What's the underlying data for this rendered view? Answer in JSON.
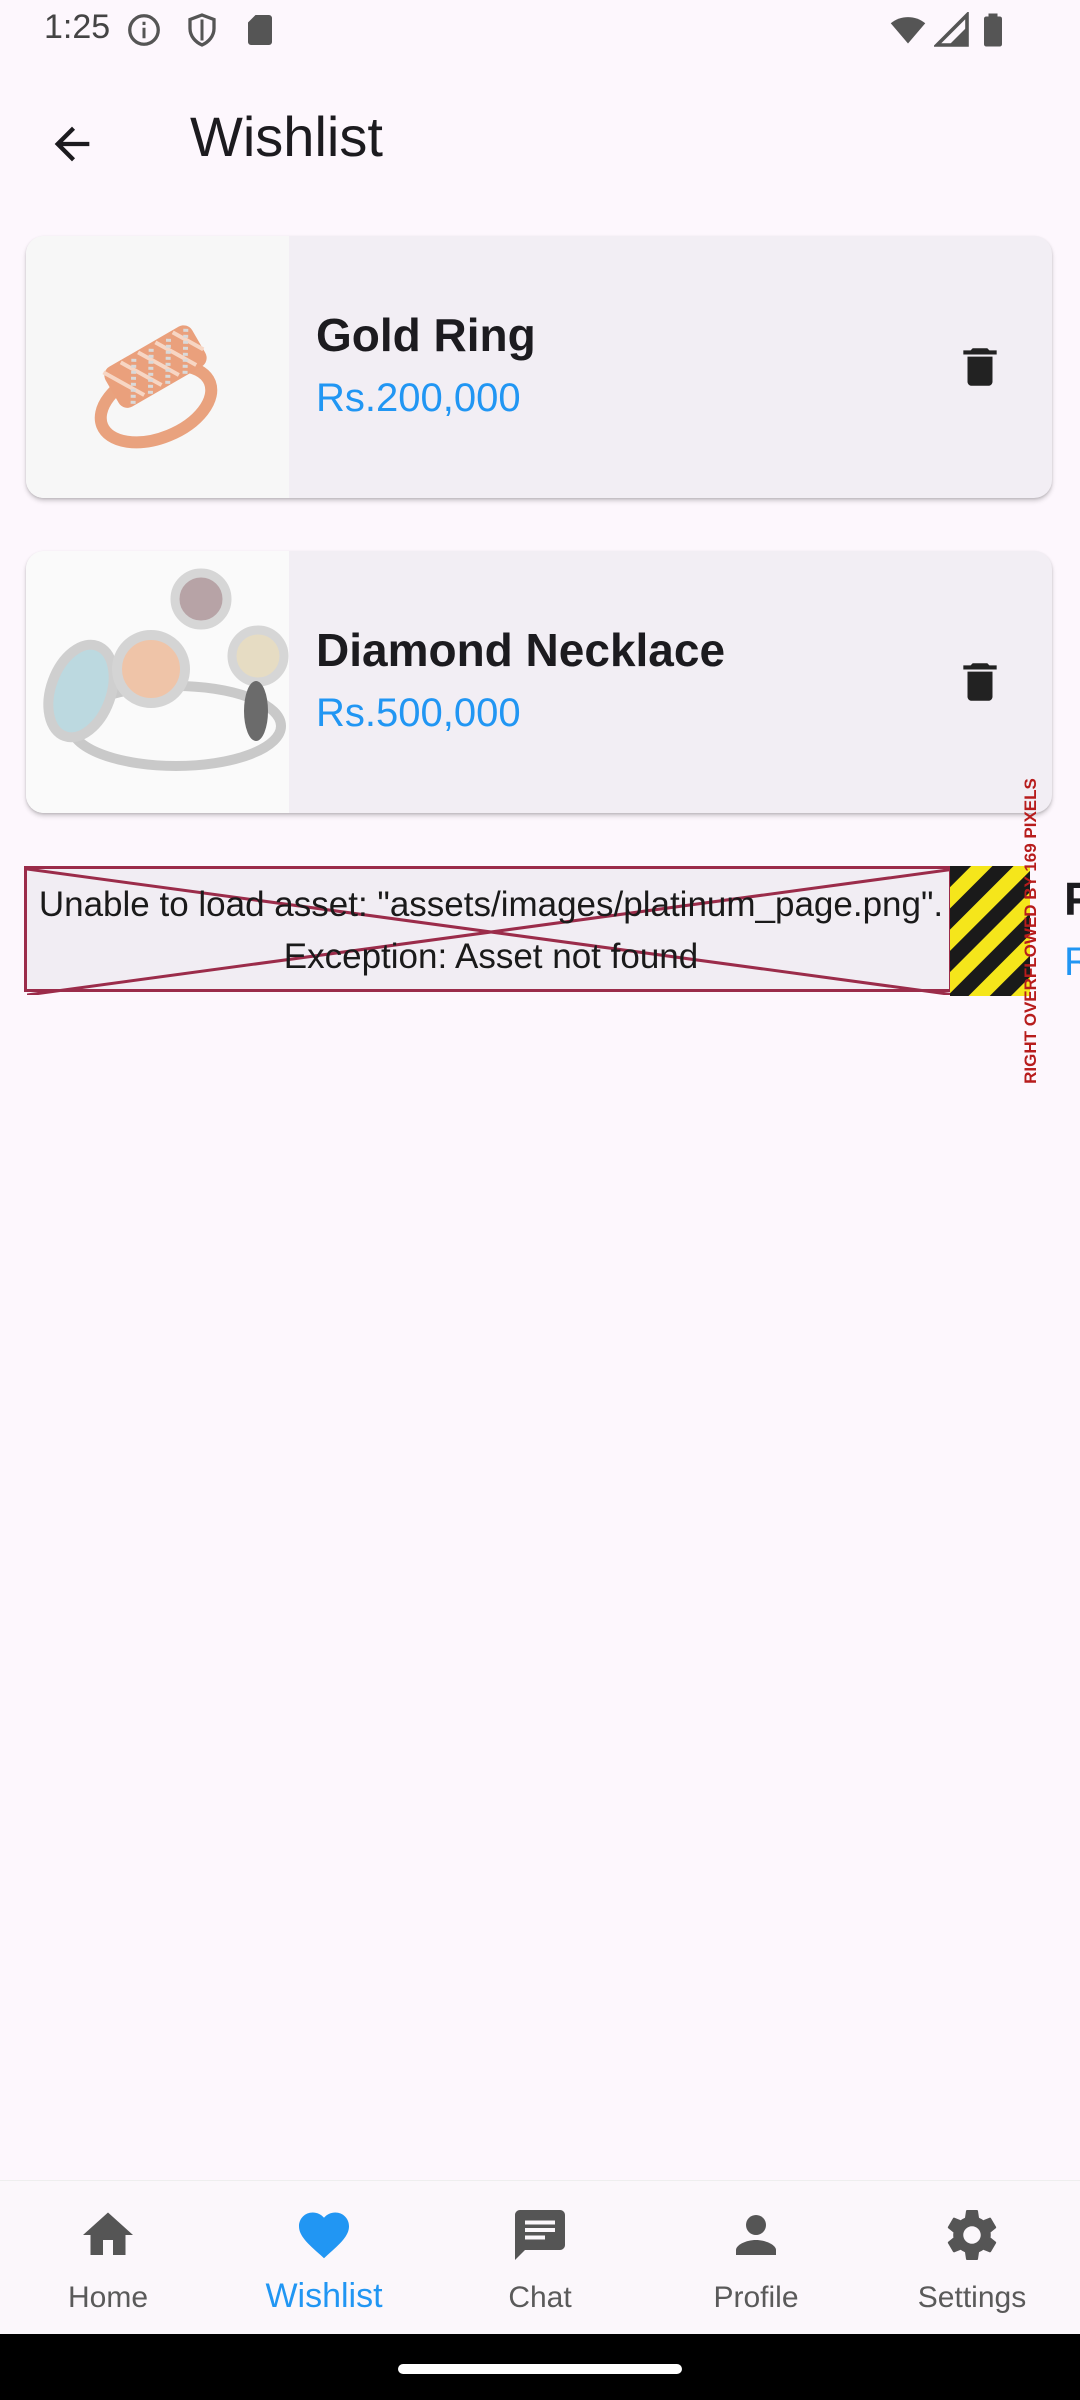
{
  "status_bar": {
    "time": "1:25",
    "left_icons": [
      "info-icon",
      "shield-icon",
      "sd-card-icon"
    ],
    "right_icons": [
      "wifi-icon",
      "signal-icon",
      "battery-icon"
    ]
  },
  "app_bar": {
    "back_icon": "arrow-back-icon",
    "title": "Wishlist"
  },
  "wishlist": [
    {
      "name": "Gold Ring",
      "price": "Rs.200,000",
      "image": "gold-ring"
    },
    {
      "name": "Diamond Necklace",
      "price": "Rs.500,000",
      "image": "diamond-ring"
    }
  ],
  "error_item": {
    "message_line1": "Unable to load asset: \"assets/images/platinum_page.png\".",
    "message_line2": "Exception: Asset not found",
    "overflow_warning": "RIGHT OVERFLOWED BY 169 PIXELS",
    "clipped_name": "P",
    "clipped_price": "R"
  },
  "bottom_nav": {
    "items": [
      {
        "label": "Home",
        "icon": "home-icon",
        "active": false
      },
      {
        "label": "Wishlist",
        "icon": "heart-icon",
        "active": true
      },
      {
        "label": "Chat",
        "icon": "chat-icon",
        "active": false
      },
      {
        "label": "Profile",
        "icon": "person-icon",
        "active": false
      },
      {
        "label": "Settings",
        "icon": "gear-icon",
        "active": false
      }
    ]
  },
  "colors": {
    "accent": "#2196f3",
    "background": "#fdf7fd",
    "card": "#f2eef4",
    "error_border": "#9b2c4a"
  }
}
